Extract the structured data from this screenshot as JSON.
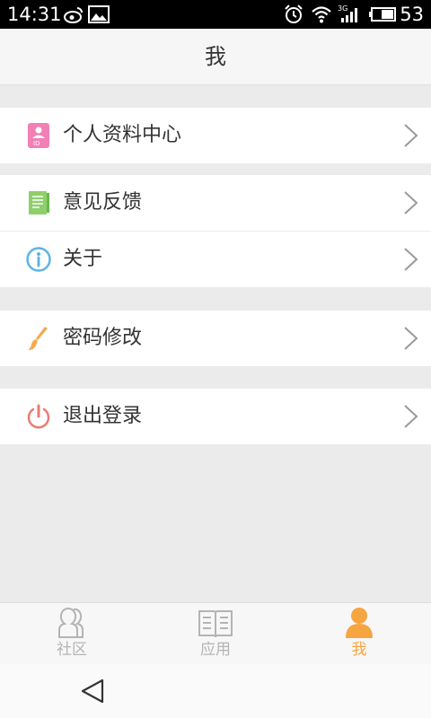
{
  "status_bar": {
    "time": "14:31",
    "battery": "53",
    "icons": [
      "weibo-icon",
      "image-icon",
      "alarm-icon",
      "wifi-icon",
      "signal-3g-icon",
      "battery-icon"
    ]
  },
  "header": {
    "title": "我"
  },
  "menu": {
    "profile": {
      "label": "个人资料中心",
      "icon": "id-badge-icon"
    },
    "feedback": {
      "label": "意见反馈",
      "icon": "notebook-icon"
    },
    "about": {
      "label": "关于",
      "icon": "info-icon"
    },
    "password": {
      "label": "密码修改",
      "icon": "brush-icon"
    },
    "logout": {
      "label": "退出登录",
      "icon": "power-icon"
    }
  },
  "tabs": [
    {
      "label": "社区",
      "icon": "community-icon",
      "active": false
    },
    {
      "label": "应用",
      "icon": "book-icon",
      "active": false
    },
    {
      "label": "我",
      "icon": "person-icon",
      "active": true
    }
  ],
  "colors": {
    "accent": "#f7a540",
    "inactive_tab": "#b4b4b4",
    "profile_icon": "#f27fb6",
    "feedback_icon": "#8fcf6a",
    "about_icon": "#5fb4e3",
    "password_icon": "#f4a94f",
    "logout_icon": "#ea7b73"
  }
}
